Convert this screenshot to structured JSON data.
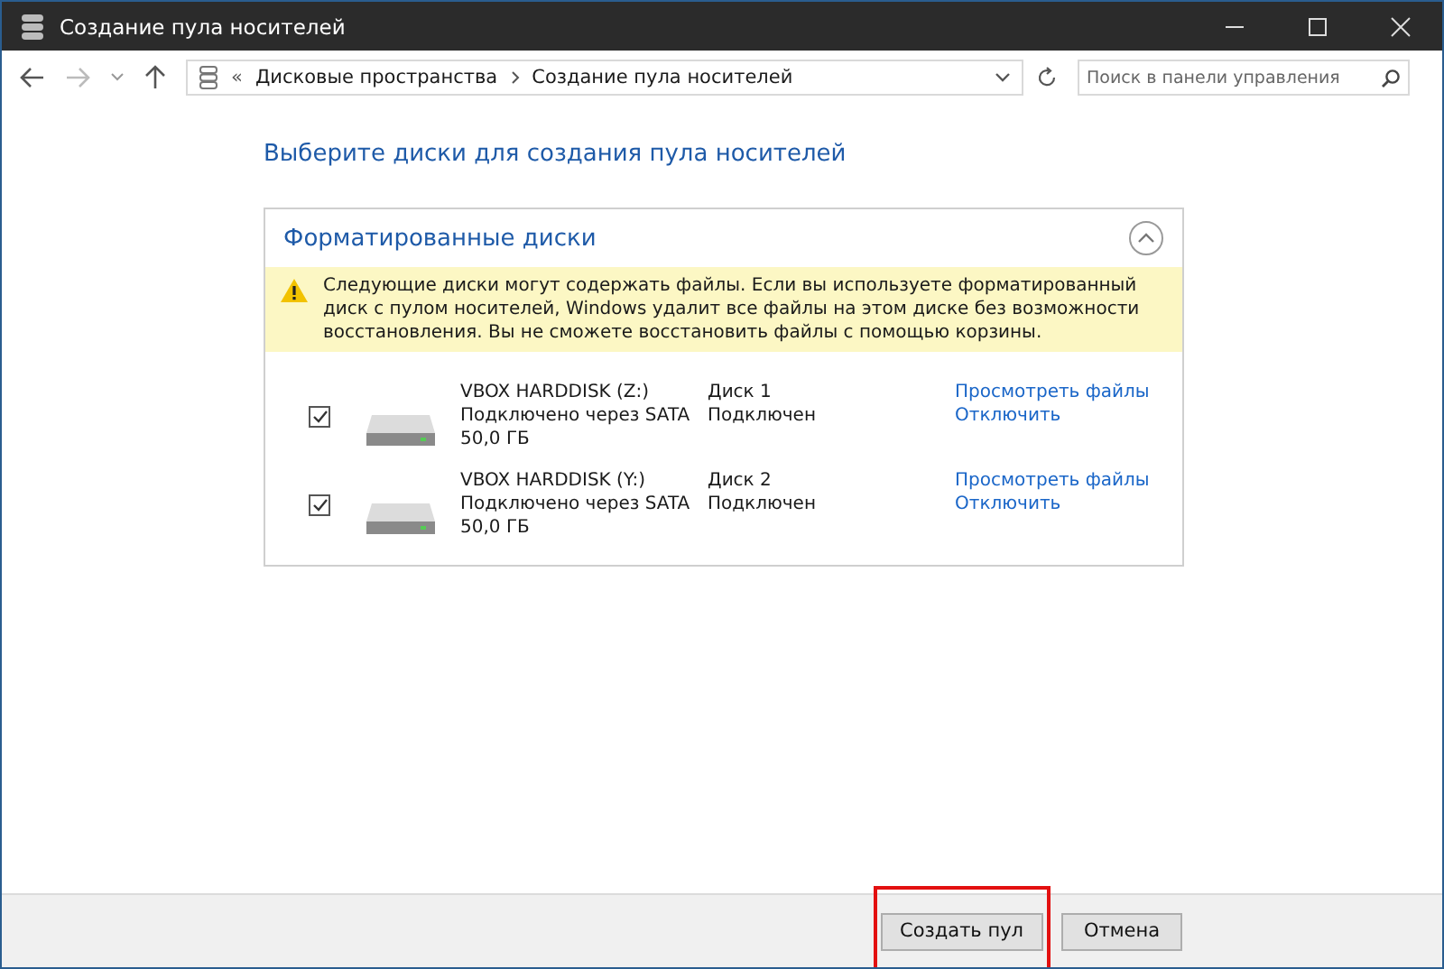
{
  "window": {
    "title": "Создание пула носителей"
  },
  "address_bar": {
    "prefix": "«",
    "crumbs": [
      "Дисковые пространства",
      "Создание пула носителей"
    ]
  },
  "search": {
    "placeholder": "Поиск в панели управления"
  },
  "heading": "Выберите диски для создания пула носителей",
  "panel": {
    "title": "Форматированные диски",
    "expanded": true,
    "warning": "Следующие диски могут содержать файлы. Если вы используете форматированный диск с пулом носителей, Windows удалит все файлы на этом диске без возможности восстановления. Вы не сможете восстановить файлы с помощью корзины.",
    "disks": [
      {
        "checked": true,
        "name": "VBOX HARDDISK (Z:)",
        "connection": "Подключено через SATA",
        "size": "50,0 ГБ",
        "disk": "Диск 1",
        "status": "Подключен",
        "links": [
          "Просмотреть файлы",
          "Отключить"
        ]
      },
      {
        "checked": true,
        "name": "VBOX HARDDISK (Y:)",
        "connection": "Подключено через SATA",
        "size": "50,0 ГБ",
        "disk": "Диск 2",
        "status": "Подключен",
        "links": [
          "Просмотреть файлы",
          "Отключить"
        ]
      }
    ]
  },
  "buttons": [
    {
      "label": "Создать пул",
      "highlighted": true
    },
    {
      "label": "Отмена"
    }
  ]
}
